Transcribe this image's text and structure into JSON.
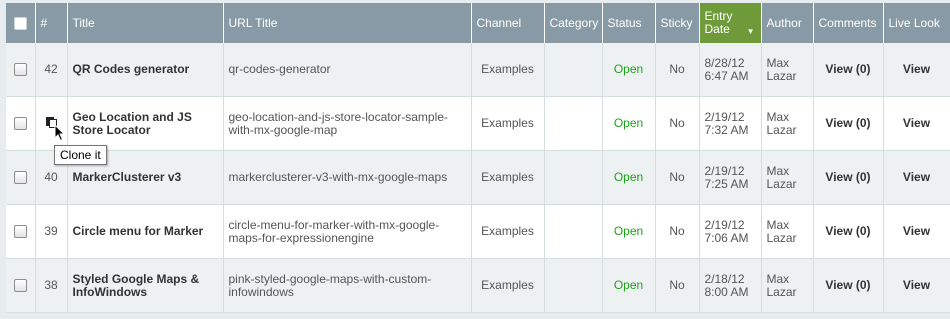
{
  "header": {
    "num": "#",
    "title": "Title",
    "url_title": "URL Title",
    "channel": "Channel",
    "category": "Category",
    "status": "Status",
    "sticky": "Sticky",
    "entry_date": "Entry Date",
    "author": "Author",
    "comments": "Comments",
    "live_look": "Live Look"
  },
  "rows": [
    {
      "id": "42",
      "title": "QR Codes generator",
      "url_title": "qr-codes-generator",
      "channel": "Examples",
      "category": "",
      "status": "Open",
      "sticky": "No",
      "entry_date": "8/28/12 6:47 AM",
      "author": "Max Lazar",
      "comments": "View (0)",
      "live_look": "View"
    },
    {
      "id": "",
      "title": "Geo Location and JS Store Locator",
      "url_title": "geo-location-and-js-store-locator-sample-with-mx-google-map",
      "channel": "Examples",
      "category": "",
      "status": "Open",
      "sticky": "No",
      "entry_date": "2/19/12 7:32 AM",
      "author": "Max Lazar",
      "comments": "View (0)",
      "live_look": "View"
    },
    {
      "id": "40",
      "title": "MarkerClusterer v3",
      "url_title": "markerclusterer-v3-with-mx-google-maps",
      "channel": "Examples",
      "category": "",
      "status": "Open",
      "sticky": "No",
      "entry_date": "2/19/12 7:25 AM",
      "author": "Max Lazar",
      "comments": "View (0)",
      "live_look": "View"
    },
    {
      "id": "39",
      "title": "Circle menu for Marker",
      "url_title": "circle-menu-for-marker-with-mx-google-maps-for-expressionengine",
      "channel": "Examples",
      "category": "",
      "status": "Open",
      "sticky": "No",
      "entry_date": "2/19/12 7:06 AM",
      "author": "Max Lazar",
      "comments": "View (0)",
      "live_look": "View"
    },
    {
      "id": "38",
      "title": "Styled Google Maps & InfoWindows",
      "url_title": "pink-styled-google-maps-with-custom-infowindows",
      "channel": "Examples",
      "category": "",
      "status": "Open",
      "sticky": "No",
      "entry_date": "2/18/12 8:00 AM",
      "author": "Max Lazar",
      "comments": "View (0)",
      "live_look": "View"
    }
  ],
  "tooltip": {
    "text": "Clone it"
  },
  "icons": {
    "clone": "clone-icon",
    "cursor": "mouse-pointer-icon",
    "sort": "sort-down-icon"
  },
  "colors": {
    "header_bg": "#889aa5",
    "sorted_header_bg": "#6f9a3a",
    "status_open": "#1ea21e"
  }
}
